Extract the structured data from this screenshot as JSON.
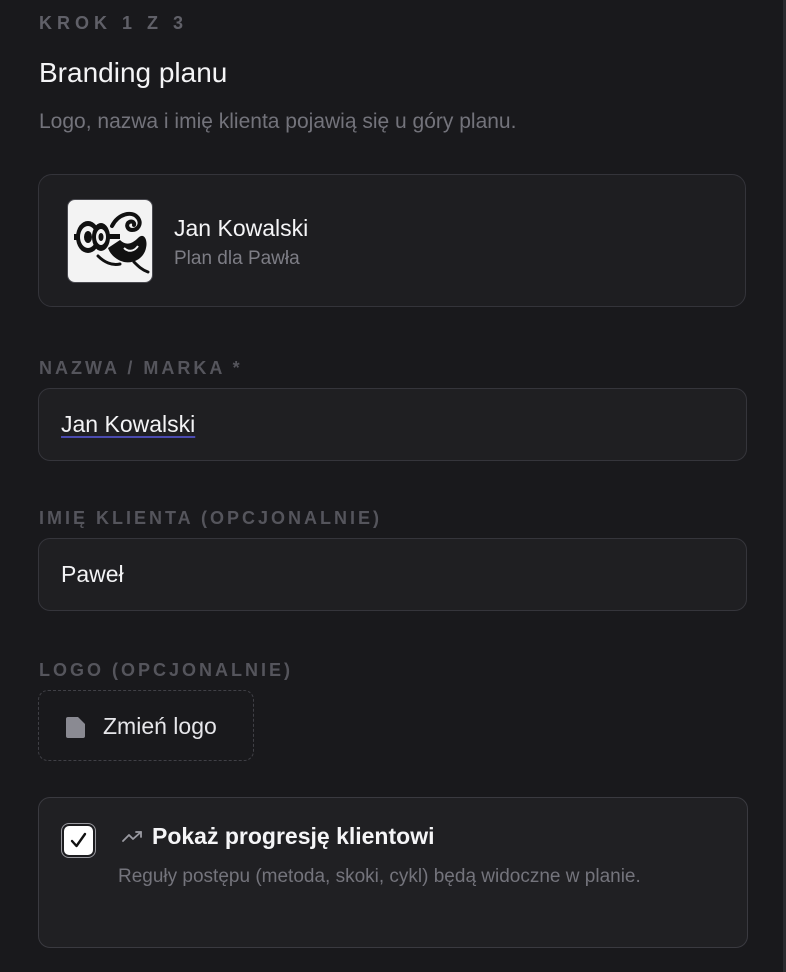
{
  "step": "KROK 1 Z 3",
  "title": "Branding planu",
  "subtitle": "Logo, nazwa i imię klienta pojawią się u góry planu.",
  "preview": {
    "name": "Jan Kowalski",
    "subtitle": "Plan dla Pawła",
    "logo_icon": "barbell-flexed-arm-logo"
  },
  "fields": {
    "brand_label": "NAZWA / MARKA *",
    "brand_value": "Jan Kowalski",
    "client_label": "IMIĘ KLIENTA (OPCJONALNIE)",
    "client_value": "Paweł",
    "logo_label": "LOGO (OPCJONALNIE)",
    "logo_button": "Zmień logo",
    "logo_button_icon": "file-icon"
  },
  "progression": {
    "checked": true,
    "icon": "trend-up-icon",
    "title": "Pokaż progresję klientowi",
    "description": "Reguły postępu (metoda, skoki, cykl) będą widoczne w planie."
  },
  "colors": {
    "background": "#19191c",
    "card": "#1e1e21",
    "border": "#35353b",
    "muted_text": "#74747c",
    "label_text": "#55555c",
    "spellcheck_underline": "#4b4bb0"
  }
}
